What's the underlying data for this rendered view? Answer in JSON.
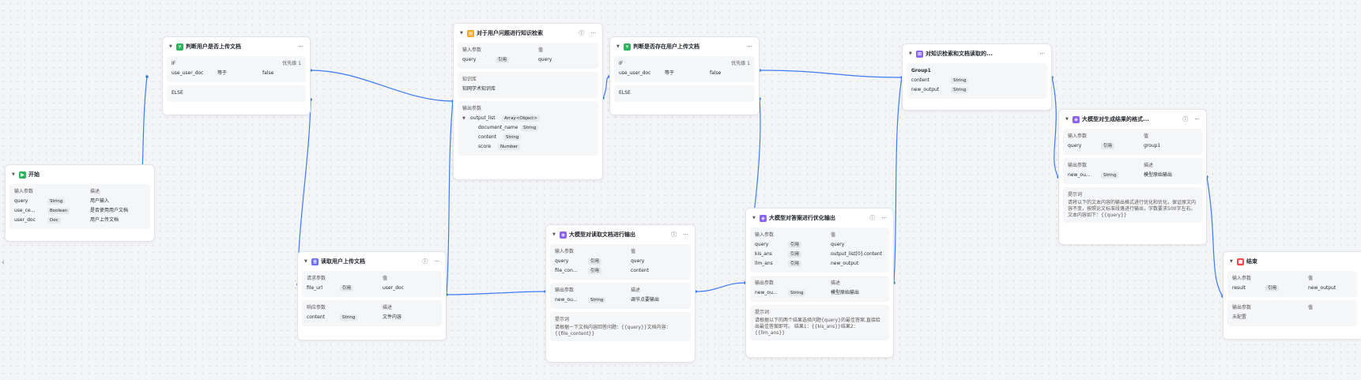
{
  "common": {
    "input": "输入参数",
    "output": "输出参数",
    "value": "值",
    "desc": "描述",
    "prompt": "提示词",
    "ref": "引用",
    "request": "请求参数",
    "response": "响应参数"
  },
  "start": {
    "title": "开始",
    "rows": [
      {
        "name": "query",
        "type": "String",
        "desc": "用户输入"
      },
      {
        "name": "use_ce...",
        "type": "Boolean",
        "desc": "是否使用用户文档"
      },
      {
        "name": "user_doc",
        "type": "Doc",
        "desc": "用户上传文档"
      }
    ]
  },
  "cond1": {
    "title": "判断用户是否上传文档",
    "if": "IF",
    "priority": "优先级 1",
    "var": "use_user_doc",
    "op": "等于",
    "val": "false",
    "else": "ELSE"
  },
  "readdoc": {
    "title": "读取用户上传文档",
    "req_name": "file_url",
    "req_val": "user_doc",
    "resp_name": "content",
    "resp_type": "String",
    "resp_desc": "文件内容"
  },
  "kb": {
    "title": "对于用户问题进行知识检索",
    "in_name": "query",
    "in_val": "query",
    "kb_label": "知识库",
    "kb_name": "知网学术知识库",
    "out_name": "output_list",
    "out_type": "Array<Object>",
    "fields": [
      {
        "name": "document_name",
        "type": "String"
      },
      {
        "name": "content",
        "type": "String"
      },
      {
        "name": "score",
        "type": "Number"
      }
    ]
  },
  "llm1": {
    "title": "大模型对读取文档进行输出",
    "in_rows": [
      {
        "name": "query",
        "val": "query"
      },
      {
        "name": "file_con...",
        "val": "content"
      }
    ],
    "out_name": "new_ou...",
    "out_type": "String",
    "out_desc": "调节点要输出",
    "prompt_text": "请根据一下文档内容回答问题：{{query}}文档内容：{{file_content}}"
  },
  "cond2": {
    "title": "判断是否存在用户上传文档",
    "if": "IF",
    "priority": "优先级 1",
    "var": "use_user_doc",
    "op": "等于",
    "val": "false",
    "else": "ELSE"
  },
  "llm2": {
    "title": "大模型对答案进行优化输出",
    "in_rows": [
      {
        "name": "query",
        "val": "query"
      },
      {
        "name": "kis_ans",
        "val": "output_list[0].content"
      },
      {
        "name": "llm_ans",
        "val": "new_output"
      }
    ],
    "out_name": "new_ou...",
    "out_type": "String",
    "out_desc": "模型原始输出",
    "prompt_text": "请根据以下的两个结果选择问题{query}的最佳答案,直接给出最佳答案即可。 结果1：{{kis_ans}}结果2：{{llm_ans}}"
  },
  "merge": {
    "title": "对知识检索和文档读取的...",
    "group": "Group1",
    "rows": [
      {
        "name": "content",
        "type": "String"
      },
      {
        "name": "new_output",
        "type": "String"
      }
    ]
  },
  "fmt": {
    "title": "大模型对生成结果的格式...",
    "in_name": "query",
    "in_val": "group1",
    "out_name": "new_ou...",
    "out_type": "String",
    "out_desc": "模型原始输出",
    "prompt_text": "请将以下的文本内容的输出格式进行优化和优化，保证原文内容不变，按照论文标准段落进行输出，字数要求500字左右。文本内容如下：{{query}}"
  },
  "end": {
    "title": "结束",
    "in_name": "result",
    "in_val": "new_output",
    "out_val": "未配置"
  }
}
